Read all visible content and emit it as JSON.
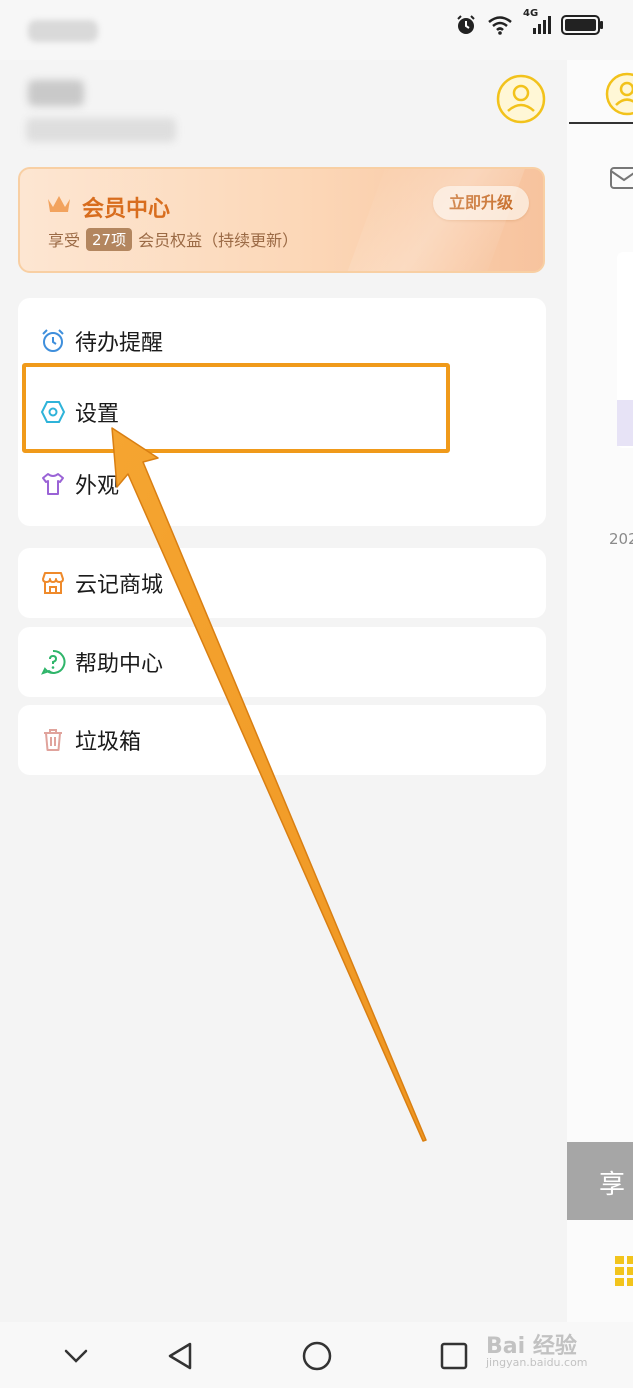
{
  "status_bar": {
    "network_label": "4G"
  },
  "vip": {
    "title": "会员中心",
    "desc_prefix": "享受",
    "desc_count": "27项",
    "desc_suffix": "会员权益（持续更新）",
    "upgrade_label": "立即升级",
    "accent_color": "#d86d1e"
  },
  "menu": {
    "group1": [
      {
        "label": "待办提醒",
        "icon": "alarm-clock-icon"
      },
      {
        "label": "设置",
        "icon": "settings-icon"
      },
      {
        "label": "外观",
        "icon": "shirt-icon"
      }
    ],
    "mall": {
      "label": "云记商城",
      "icon": "store-icon"
    },
    "help": {
      "label": "帮助中心",
      "icon": "help-icon"
    },
    "trash": {
      "label": "垃圾箱",
      "icon": "trash-icon"
    }
  },
  "right_panel": {
    "year_partial": "202",
    "banner_text": "享"
  },
  "annotation": {
    "highlight_color": "#f09a1a",
    "highlight_target": "设置"
  },
  "watermark": {
    "line1": "Bai 经验",
    "line2": "jingyan.baidu.com"
  }
}
